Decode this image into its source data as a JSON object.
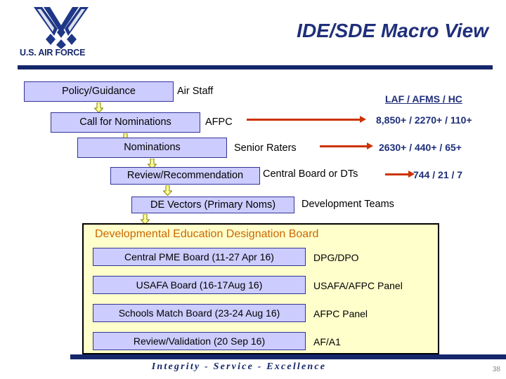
{
  "slide": {
    "title": "IDE/SDE Macro View",
    "logo": {
      "wordmark": "U.S. AIR FORCE",
      "symbol": "usaf-wing-symbol"
    },
    "footer": {
      "tagline": "Integrity - Service - Excellence",
      "page_number": "38"
    }
  },
  "flow": {
    "steps": [
      {
        "box": "Policy/Guidance",
        "owner": "Air Staff"
      },
      {
        "box": "Call for Nominations",
        "owner": "AFPC"
      },
      {
        "box": "Nominations",
        "owner": "Senior Raters"
      },
      {
        "box": "Review/Recommendation",
        "owner": "Central Board or DTs"
      },
      {
        "box": "DE Vectors (Primary Noms)",
        "owner": "Development Teams"
      }
    ]
  },
  "counts": {
    "header": "LAF / AFMS / HC",
    "rows": [
      "8,850+ / 2270+ / 110+",
      "2630+ / 440+ / 65+",
      "744 /  21  / 7"
    ]
  },
  "de_board": {
    "title": "Developmental Education Designation Board",
    "rows": [
      {
        "event": "Central PME Board (11-27 Apr 16)",
        "owner": "DPG/DPO"
      },
      {
        "event": "USAFA Board  (16-17Aug 16)",
        "owner": "USAFA/AFPC Panel"
      },
      {
        "event": "Schools Match Board (23-24 Aug 16)",
        "owner": "AFPC Panel"
      },
      {
        "event": "Review/Validation (20 Sep 16)",
        "owner": "AF/A1"
      }
    ]
  },
  "colors": {
    "navy": "#15276b",
    "title_blue": "#1f2f7a",
    "box_fill": "#ccccff",
    "box_border": "#333399",
    "arrow_red": "#cc3300",
    "arrow_yellow": "#ffff99",
    "panel_fill": "#ffffcc",
    "panel_title": "#cc6600"
  }
}
